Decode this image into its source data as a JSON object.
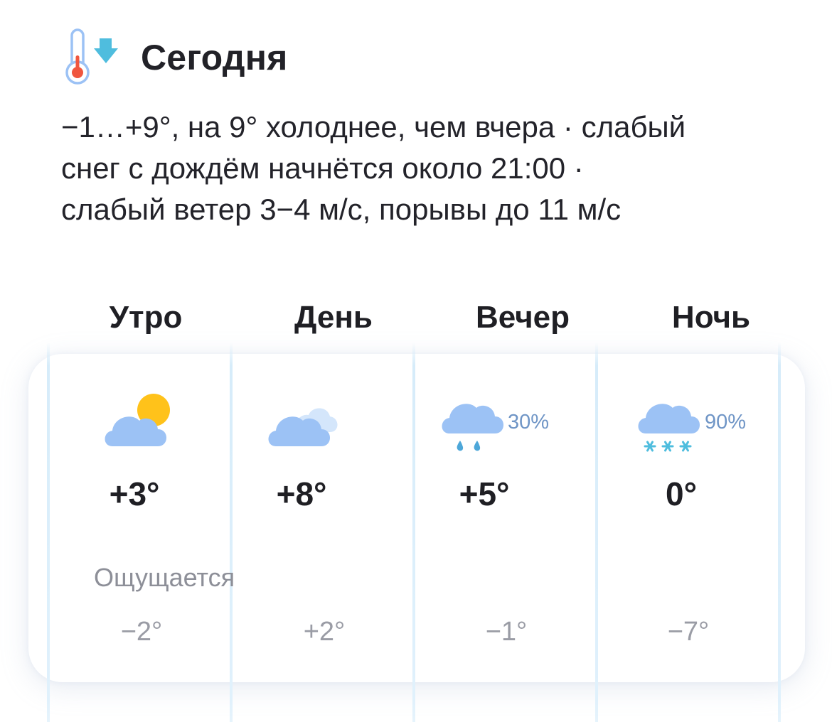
{
  "header": {
    "title": "Сегодня",
    "icon": "thermometer-down-icon"
  },
  "summary": {
    "lines": [
      "−1…+9°, на 9° холоднее, чем вчера · слабый",
      "снег с дождём начнётся около 21:00 ·",
      "слабый ветер 3−4 м/с, порывы до 11 м/с"
    ]
  },
  "periods": [
    {
      "label": "Утро",
      "icon": "cloud-sun-icon",
      "precip": "",
      "temp": "+3°",
      "feels": "−2°"
    },
    {
      "label": "День",
      "icon": "cloud-cloud-icon",
      "precip": "",
      "temp": "+8°",
      "feels": "+2°"
    },
    {
      "label": "Вечер",
      "icon": "cloud-rain-icon",
      "precip": "30%",
      "temp": "+5°",
      "feels": "−1°"
    },
    {
      "label": "Ночь",
      "icon": "cloud-snow-icon",
      "precip": "90%",
      "temp": "0°",
      "feels": "−7°"
    }
  ],
  "feels_label": "Ощущается",
  "colors": {
    "cloud": "#9cc2f5",
    "sun": "#ffc21a",
    "rain": "#4da7d9",
    "snow": "#4fbdde",
    "precip_text": "#6f95c6",
    "separator": "#dcedfa"
  }
}
